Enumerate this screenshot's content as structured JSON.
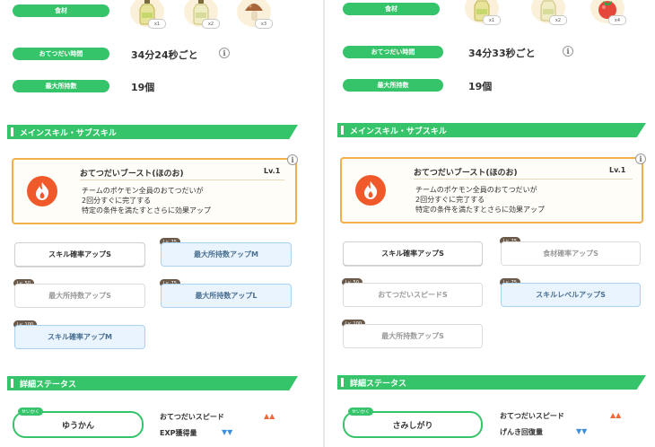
{
  "left": {
    "rows": {
      "ingredients_label": "食材",
      "help_time_label": "おてつだい時間",
      "help_time_value": "34分24秒ごと",
      "max_carry_label": "最大所持数",
      "max_carry_value": "19個"
    },
    "ingredients": [
      {
        "icon": "oil-bottle-icon",
        "badge": "x1"
      },
      {
        "icon": "oil-bottle-icon",
        "badge": "x2"
      },
      {
        "icon": "mushroom-icon",
        "badge": "x3"
      }
    ],
    "skills_header": "メインスキル・サブスキル",
    "main_skill": {
      "name": "おてつだいブースト(ほのお)",
      "level": "Lv.1",
      "desc1": "チームのポケモン全員のおてつだいが",
      "desc2": "2回分すぐに完了する",
      "desc3": "特定の条件を満たすとさらに効果アップ"
    },
    "subskills": [
      {
        "label": "スキル確率アップS",
        "tag": ""
      },
      {
        "label": "最大所持数アップM",
        "tag": "Lv. 25"
      },
      {
        "label": "最大所持数アップS",
        "tag": "Lv. 50"
      },
      {
        "label": "最大所持数アップL",
        "tag": "Lv. 75"
      },
      {
        "label": "スキル確率アップM",
        "tag": "Lv. 100"
      }
    ],
    "details_header": "詳細ステータス",
    "nature_tag": "せいかく",
    "nature": "ゆうかん",
    "effects": [
      {
        "label": "おてつだいスピード",
        "arrows": "▲▲",
        "dir": "up"
      },
      {
        "label": "EXP獲得量",
        "arrows": "▼▼",
        "dir": "down"
      }
    ]
  },
  "right": {
    "rows": {
      "ingredients_label": "食材",
      "help_time_label": "おてつだい時間",
      "help_time_value": "34分33秒ごと",
      "max_carry_label": "最大所持数",
      "max_carry_value": "19個"
    },
    "ingredients": [
      {
        "icon": "oil-bottle-icon",
        "badge": "x1"
      },
      {
        "icon": "oil-bottle-icon",
        "badge": "x2"
      },
      {
        "icon": "tomato-icon",
        "badge": "x4"
      }
    ],
    "skills_header": "メインスキル・サブスキル",
    "main_skill": {
      "name": "おてつだいブースト(ほのお)",
      "level": "Lv.1",
      "desc1": "チームのポケモン全員のおてつだいが",
      "desc2": "2回分すぐに完了する",
      "desc3": "特定の条件を満たすとさらに効果アップ"
    },
    "subskills": [
      {
        "label": "スキル確率アップS",
        "tag": ""
      },
      {
        "label": "食材確率アップS",
        "tag": "Lv. 25"
      },
      {
        "label": "おてつだいスピードS",
        "tag": "Lv. 50"
      },
      {
        "label": "スキルレベルアップS",
        "tag": "Lv. 75"
      },
      {
        "label": "最大所持数アップS",
        "tag": "Lv. 100"
      }
    ],
    "details_header": "詳細ステータス",
    "nature_tag": "せいかく",
    "nature": "さみしがり",
    "effects": [
      {
        "label": "おてつだいスピード",
        "arrows": "▲▲",
        "dir": "up"
      },
      {
        "label": "げんき回復量",
        "arrows": "▼▼",
        "dir": "down"
      }
    ]
  },
  "info_glyph": "i",
  "colors": {
    "accent_green": "#36c46a",
    "skill_border": "#f2b04c",
    "skill_icon": "#f05a2a",
    "up_arrow": "#ee6a3c",
    "down_arrow": "#3f8fe0"
  }
}
